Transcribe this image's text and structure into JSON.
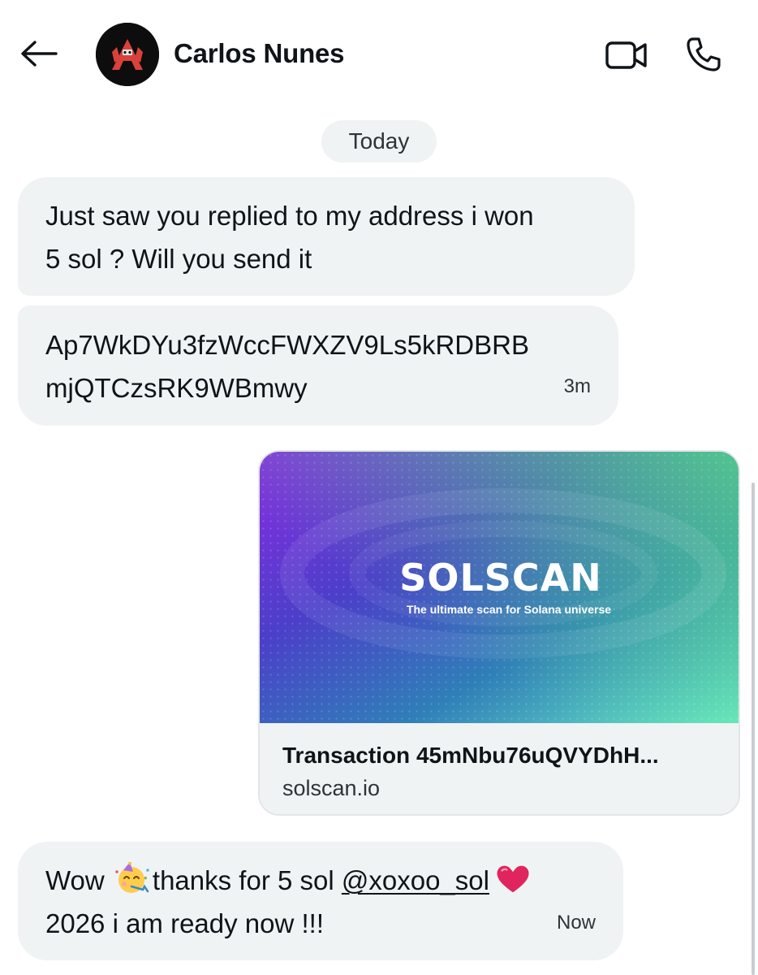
{
  "header": {
    "contact_name": "Carlos Nunes",
    "back_icon": "arrow-left-icon",
    "video_icon": "video-camera-icon",
    "call_icon": "phone-icon"
  },
  "conversation": {
    "date_separator": "Today",
    "messages": [
      {
        "sender": "contact",
        "lines": [
          "Just saw you replied to my address i won",
          "5 sol ? Will you send it"
        ]
      },
      {
        "sender": "contact",
        "lines": [
          "Ap7WkDYu3fzWccFWXZV9Ls5kRDBRB",
          "mjQTCzsRK9WBmwy"
        ],
        "time": "3m"
      },
      {
        "sender": "me",
        "type": "link_card",
        "image": {
          "brand": "SOLSCAN",
          "tagline": "The ultimate scan for Solana universe"
        },
        "title": "Transaction 45mNbu76uQVYDhH...",
        "domain": "solscan.io"
      },
      {
        "sender": "contact",
        "line1": {
          "before": "Wow ",
          "emoji": "partying-face-emoji",
          "middle": "thanks for 5 sol ",
          "mention": "@xoxoo_sol",
          "after_emoji": "red-heart-emoji"
        },
        "line2": "2026 i am ready now !!!",
        "time": "Now"
      }
    ]
  },
  "colors": {
    "bubble_bg": "#eff3f4",
    "text": "#0f1419",
    "muted": "#2f3336",
    "heart": "#e0245e"
  }
}
